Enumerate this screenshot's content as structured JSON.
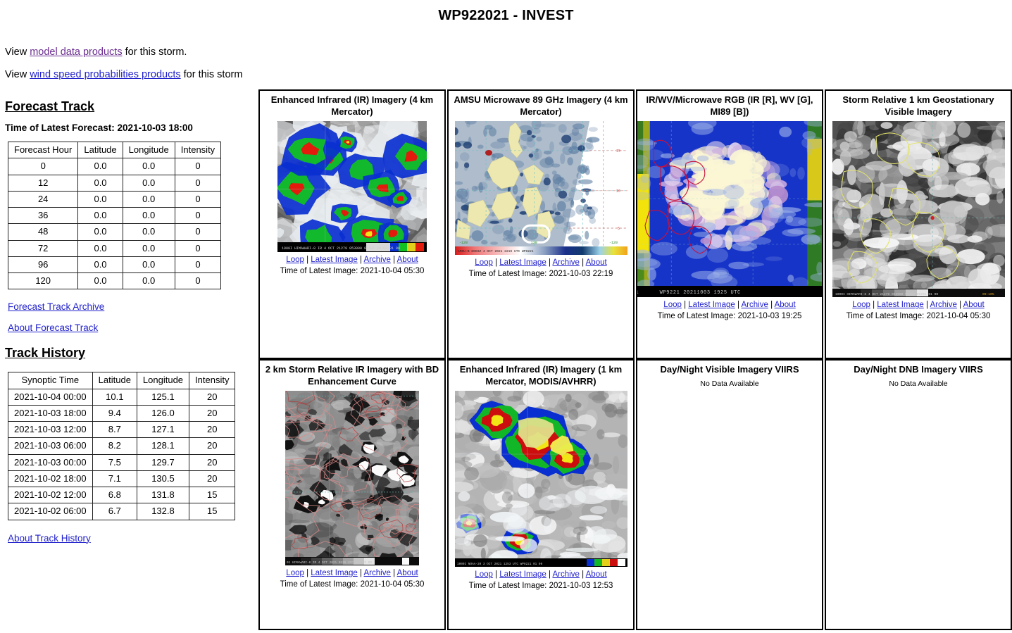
{
  "page": {
    "title": "WP922021 - INVEST"
  },
  "top_links": {
    "line1_prefix": "View ",
    "line1_link": "model data products",
    "line1_suffix": " for this storm.",
    "line2_prefix": "View ",
    "line2_link": "wind speed probabilities products",
    "line2_suffix": " for this storm"
  },
  "forecast_track": {
    "heading": "Forecast Track",
    "latest_forecast_label": "Time of Latest Forecast: 2021-10-03 18:00",
    "columns": [
      "Forecast Hour",
      "Latitude",
      "Longitude",
      "Intensity"
    ],
    "rows": [
      [
        "0",
        "0.0",
        "0.0",
        "0"
      ],
      [
        "12",
        "0.0",
        "0.0",
        "0"
      ],
      [
        "24",
        "0.0",
        "0.0",
        "0"
      ],
      [
        "36",
        "0.0",
        "0.0",
        "0"
      ],
      [
        "48",
        "0.0",
        "0.0",
        "0"
      ],
      [
        "72",
        "0.0",
        "0.0",
        "0"
      ],
      [
        "96",
        "0.0",
        "0.0",
        "0"
      ],
      [
        "120",
        "0.0",
        "0.0",
        "0"
      ]
    ],
    "archive_link": "Forecast Track Archive",
    "about_link": "About Forecast Track"
  },
  "track_history": {
    "heading": "Track History",
    "columns": [
      "Synoptic Time",
      "Latitude",
      "Longitude",
      "Intensity"
    ],
    "rows": [
      [
        "2021-10-04 00:00",
        "10.1",
        "125.1",
        "20"
      ],
      [
        "2021-10-03 18:00",
        "9.4",
        "126.0",
        "20"
      ],
      [
        "2021-10-03 12:00",
        "8.7",
        "127.1",
        "20"
      ],
      [
        "2021-10-03 06:00",
        "8.2",
        "128.1",
        "20"
      ],
      [
        "2021-10-03 00:00",
        "7.5",
        "129.7",
        "20"
      ],
      [
        "2021-10-02 18:00",
        "7.1",
        "130.5",
        "20"
      ],
      [
        "2021-10-02 12:00",
        "6.8",
        "131.8",
        "15"
      ],
      [
        "2021-10-02 06:00",
        "6.7",
        "132.8",
        "15"
      ]
    ],
    "about_link": "About Track History"
  },
  "image_links": {
    "loop": "Loop",
    "latest": "Latest Image",
    "archive": "Archive",
    "about": "About",
    "separator": "|",
    "time_prefix": "Time of Latest Image: "
  },
  "panels": [
    {
      "title": "Enhanced Infrared (IR) Imagery (4 km Mercator)",
      "has_image": true,
      "image_kind": "enhanced-ir",
      "latest_image_time": "2021-10-04 05:30",
      "overlay_text": ""
    },
    {
      "title": "AMSU Microwave 89 GHz Imagery (4 km Mercator)",
      "has_image": true,
      "image_kind": "amsu-89",
      "latest_image_time": "2021-10-03 22:19",
      "overlay_text": ""
    },
    {
      "title": "IR/WV/Microwave RGB (IR [R], WV [G], MI89 [B])",
      "has_image": true,
      "image_kind": "rgb-composite",
      "latest_image_time": "2021-10-03 19:25",
      "overlay_text": "WP9221 20211003 1925 UTC"
    },
    {
      "title": "Storm Relative 1 km Geostationary Visible Imagery",
      "has_image": true,
      "image_kind": "visible-gray",
      "latest_image_time": "2021-10-04 05:30",
      "overlay_text": ""
    },
    {
      "title": "2 km Storm Relative IR Imagery with BD Enhancement Curve",
      "has_image": true,
      "image_kind": "bd-enhancement",
      "latest_image_time": "2021-10-04 05:30",
      "overlay_text": ""
    },
    {
      "title": "Enhanced Infrared (IR) Imagery (1 km Mercator, MODIS/AVHRR)",
      "has_image": true,
      "image_kind": "modis-ir",
      "latest_image_time": "2021-10-03 12:53",
      "overlay_text": ""
    },
    {
      "title": "Day/Night Visible Imagery VIIRS",
      "has_image": false,
      "no_data_text": "No Data Available"
    },
    {
      "title": "Day/Night DNB Imagery VIIRS",
      "has_image": false,
      "no_data_text": "No Data Available"
    }
  ],
  "colors": {
    "link_blue": "#2222cc",
    "link_visited": "#6a2d8f",
    "text": "#000000",
    "background": "#ffffff",
    "panel_border": "#000000"
  }
}
